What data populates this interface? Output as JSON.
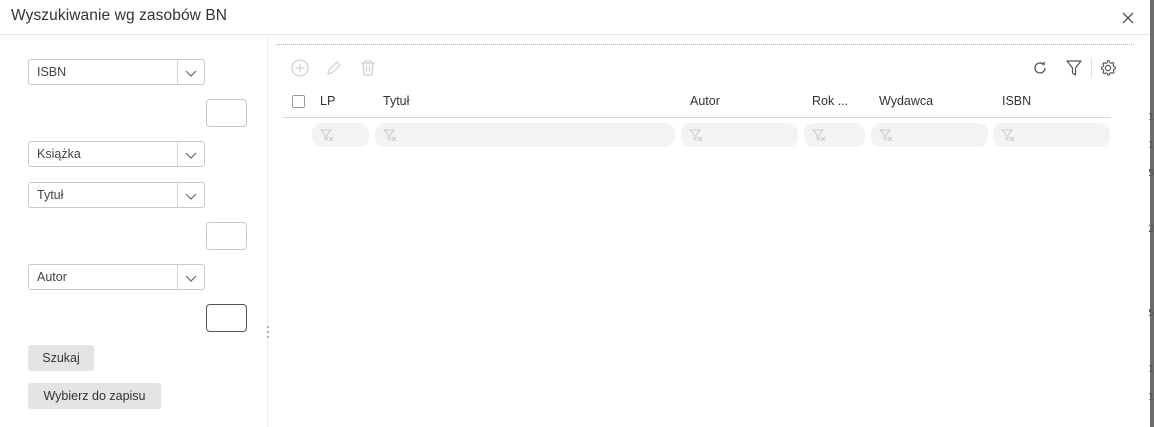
{
  "dialog": {
    "title": "Wyszukiwanie wg zasobów BN"
  },
  "left_panel": {
    "fields": [
      {
        "value": "ISBN"
      },
      {
        "value": "Książka"
      },
      {
        "value": "Tytuł"
      },
      {
        "value": "Autor"
      }
    ],
    "search_button": "Szukaj",
    "select_button": "Wybierz do zapisu"
  },
  "table": {
    "columns": [
      "LP",
      "Tytuł",
      "Autor",
      "Rok ...",
      "Wydawca",
      "ISBN"
    ]
  },
  "background_edge": [
    "1",
    "1",
    "5",
    "2",
    "5",
    "1",
    "1"
  ],
  "colors": {
    "text": "#333333",
    "button_bg": "#e4e4e4",
    "filter_bg": "#f3f3f3",
    "icon_gray": "#9a9a9a"
  }
}
